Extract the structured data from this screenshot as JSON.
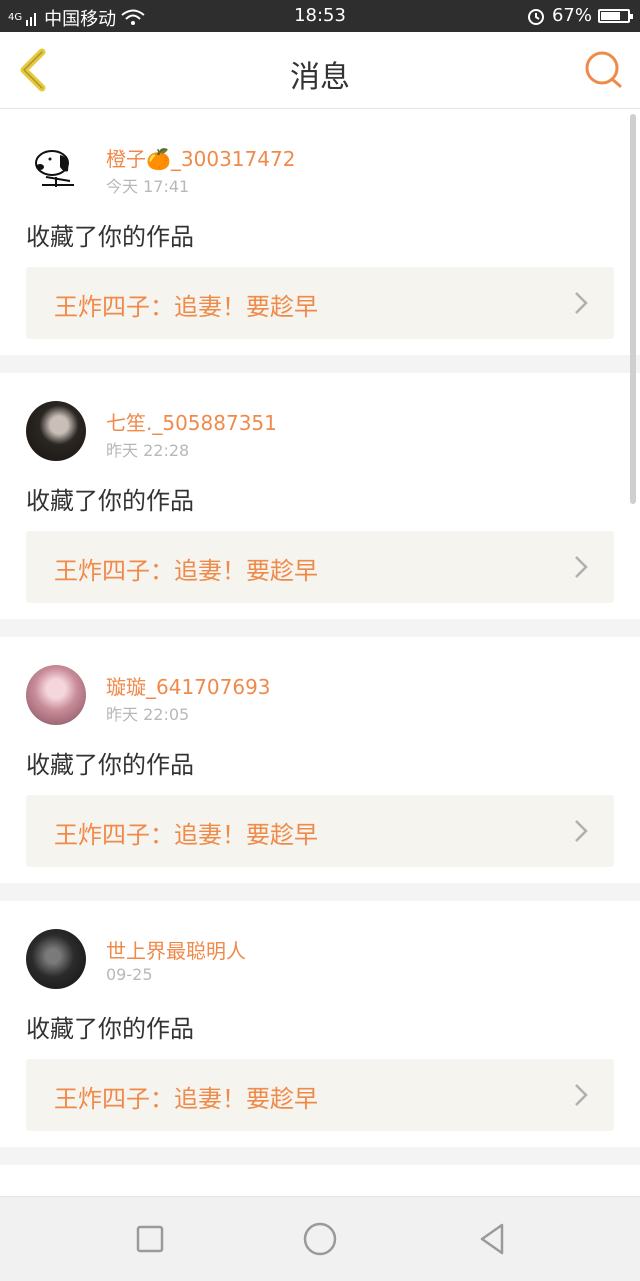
{
  "status_bar": {
    "signal_text": "4G",
    "carrier": "中国移动",
    "time": "18:53",
    "battery": "67%",
    "battery_level": 0.67
  },
  "header": {
    "title": "消息",
    "back_icon": "chevron-left-icon",
    "search_icon": "search-icon"
  },
  "messages": [
    {
      "username": "橙子🍊_300317472",
      "time": "今天 17:41",
      "action": "收藏了你的作品",
      "work_title": "王炸四子：追妻！要趁早"
    },
    {
      "username": "七笙._505887351",
      "time": "昨天 22:28",
      "action": "收藏了你的作品",
      "work_title": "王炸四子：追妻！要趁早"
    },
    {
      "username": "璇璇_641707693",
      "time": "昨天 22:05",
      "action": "收藏了你的作品",
      "work_title": "王炸四子：追妻！要趁早"
    },
    {
      "username": "世上界最聪明人",
      "time": "09-25",
      "action": "收藏了你的作品",
      "work_title": "王炸四子：追妻！要趁早"
    }
  ],
  "colors": {
    "accent": "#f08a4b",
    "back_icon": "#e8c93a",
    "card_bg": "#f5f4ee"
  }
}
